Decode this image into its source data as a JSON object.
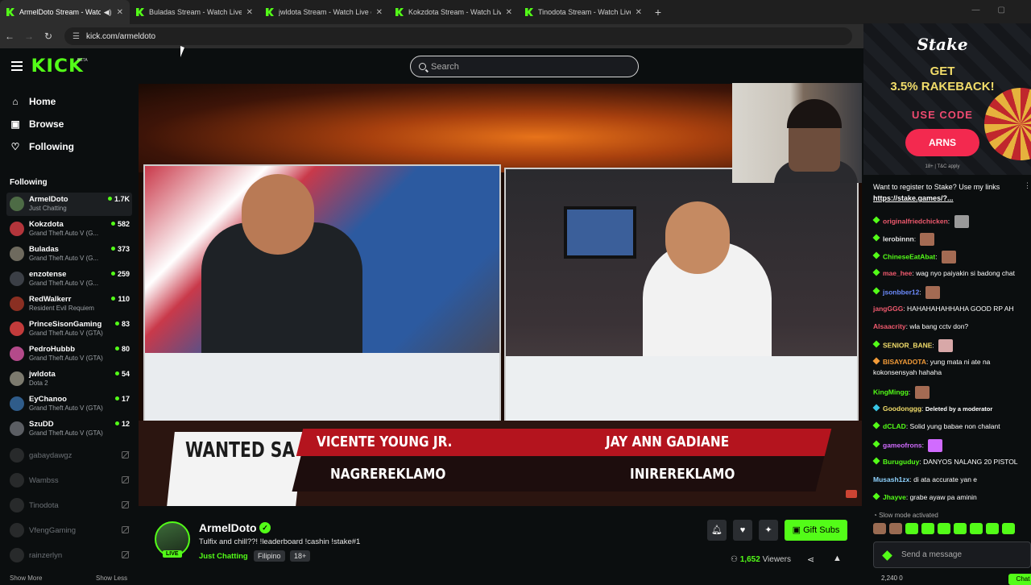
{
  "browser": {
    "tabs": [
      {
        "title": "ArmelDoto Stream - Watch",
        "active": true,
        "audio": true
      },
      {
        "title": "Buladas Stream - Watch Live o",
        "active": false
      },
      {
        "title": "jwldota Stream - Watch Live on",
        "active": false
      },
      {
        "title": "Kokzdota Stream - Watch Live",
        "active": false
      },
      {
        "title": "Tinodota Stream - Watch Live o",
        "active": false
      }
    ],
    "new_tab": "+",
    "url": "kick.com/armeldoto"
  },
  "header": {
    "logo": "KICK",
    "beta": "BETA",
    "search_placeholder": "Search"
  },
  "sidebar": {
    "nav": [
      {
        "label": "Home",
        "icon": "home-icon"
      },
      {
        "label": "Browse",
        "icon": "browse-icon"
      },
      {
        "label": "Following",
        "icon": "heart-icon"
      }
    ],
    "following_title": "Following",
    "following": [
      {
        "name": "ArmelDoto",
        "game": "Just Chatting",
        "viewers": "1.7K",
        "live": true
      },
      {
        "name": "Kokzdota",
        "game": "Grand Theft Auto V (G...",
        "viewers": "582",
        "live": true
      },
      {
        "name": "Buladas",
        "game": "Grand Theft Auto V (G...",
        "viewers": "373",
        "live": true
      },
      {
        "name": "enzotense",
        "game": "Grand Theft Auto V (G...",
        "viewers": "259",
        "live": true
      },
      {
        "name": "RedWalkerr",
        "game": "Resident Evil Requiem",
        "viewers": "110",
        "live": true
      },
      {
        "name": "PrinceSisonGaming",
        "game": "Grand Theft Auto V (GTA)",
        "viewers": "83",
        "live": true
      },
      {
        "name": "PedroHubbb",
        "game": "Grand Theft Auto V (GTA)",
        "viewers": "80",
        "live": true
      },
      {
        "name": "jwldota",
        "game": "Dota 2",
        "viewers": "54",
        "live": true
      },
      {
        "name": "EyChanoo",
        "game": "Grand Theft Auto V (GTA)",
        "viewers": "17",
        "live": true
      },
      {
        "name": "SzuDD",
        "game": "Grand Theft Auto V (GTA)",
        "viewers": "12",
        "live": true
      },
      {
        "name": "gabaydawgz",
        "live": false
      },
      {
        "name": "Wambss",
        "live": false
      },
      {
        "name": "Tinodota",
        "live": false
      },
      {
        "name": "VfengGaming",
        "live": false
      },
      {
        "name": "rainzerlyn",
        "live": false
      }
    ],
    "show_more": "Show More",
    "show_less": "Show Less"
  },
  "video": {
    "lower_third": {
      "show": "WANTED SA RADYO",
      "left_name": "VICENTE YOUNG JR.",
      "left_role": "NAGREREKLAMO",
      "right_name": "JAY ANN GADIANE",
      "right_role": "INIREREKLAMO"
    }
  },
  "stream": {
    "name": "ArmelDoto",
    "live_badge": "LIVE",
    "title": "Tulfix and chill??! !leaderboard !cashin !stake#1",
    "category": "Just Chatting",
    "tags": [
      "Filipino",
      "18+"
    ],
    "gift_label": "Gift Subs",
    "viewers_count": "1,652",
    "viewers_label": "Viewers"
  },
  "ad": {
    "brand": "Stake",
    "headline_1": "GET",
    "headline_2": "3.5% RAKEBACK!",
    "use_code": "USE CODE",
    "code": "ARNS",
    "tc": "18+ | T&C apply"
  },
  "chat": {
    "pinned_text": "Want to register to Stake? Use my links",
    "pinned_link": "https://stake.games/?...",
    "messages": [
      {
        "user": "originalfriedchicken",
        "color": "#f05a6e",
        "text": "",
        "emote": true,
        "badge": true
      },
      {
        "user": "lerobinnn",
        "color": "#e7e7e7",
        "text": "",
        "emote": true,
        "badge": true
      },
      {
        "user": "ChineseEatAbat",
        "color": "#53fc18",
        "text": "",
        "emote": true,
        "badge": true
      },
      {
        "user": "mae_hee",
        "color": "#f05a6e",
        "text": "wag nyo paiyakin si badong chat",
        "badge": true
      },
      {
        "user": "jsonbber12",
        "color": "#6d8cff",
        "text": "",
        "emote": true,
        "badge": true
      },
      {
        "user": "jangGGG",
        "color": "#f05a6e",
        "text": "HAHAHAHAHHAHA GOOD RP AH",
        "badge": false
      },
      {
        "user": "Alsaacrity",
        "color": "#f05a6e",
        "text": "wla bang cctv don?",
        "badge": false
      },
      {
        "user": "SENIOR_BANE",
        "color": "#f2dd6a",
        "text": "",
        "emote": true,
        "badge": true
      },
      {
        "user": "BISAYADOTA",
        "color": "#f29b38",
        "text": "yung mata ni ate na",
        "text2": "kokonsensyah hahaha",
        "badge": true
      },
      {
        "user": "KingMingg",
        "color": "#53fc18",
        "text": "",
        "emote": true,
        "badge": false
      },
      {
        "user": "Goodonggg",
        "color": "#f2dd6a",
        "text": "Deleted by a moderator",
        "badge": true
      },
      {
        "user": "dCLAD",
        "color": "#53fc18",
        "text": "Solid yung babae non chalant",
        "badge": true
      },
      {
        "user": "gameofrons",
        "color": "#d16bff",
        "text": "",
        "emote": true,
        "badge": true
      },
      {
        "user": "Buruguduy",
        "color": "#53fc18",
        "text": "DANYOS NALANG 20 PISTOL",
        "badge": true
      },
      {
        "user": "Musash1zx",
        "color": "#8fd3ff",
        "text": "di ata accurate yan e",
        "badge": false
      },
      {
        "user": "Jhayve",
        "color": "#53fc18",
        "text": "grabe ayaw pa aminin",
        "badge": true
      }
    ],
    "slow_mode": "Slow mode activated",
    "send_placeholder": "Send a message",
    "bottom_count": "2,240",
    "bottom_count2": "0",
    "chat_button": "Chat"
  }
}
